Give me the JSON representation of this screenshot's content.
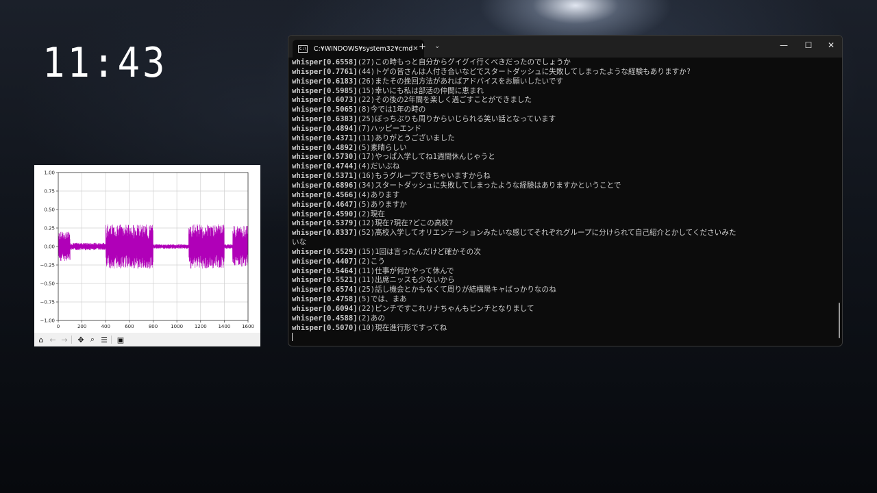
{
  "clock": {
    "time": "11:43"
  },
  "plot": {
    "toolbar_icons": [
      "home-icon",
      "back-arrow-icon",
      "forward-arrow-icon",
      "move-icon",
      "zoom-icon",
      "configure-icon",
      "save-icon"
    ]
  },
  "chart_data": {
    "type": "line",
    "yticks": [
      "1.00",
      "0.75",
      "0.50",
      "0.25",
      "0.00",
      "−0.25",
      "−0.50",
      "−0.75",
      "−1.00"
    ],
    "xticks": [
      "0",
      "200",
      "400",
      "600",
      "800",
      "1000",
      "1200",
      "1400",
      "1600"
    ],
    "xlim": [
      0,
      1600
    ],
    "ylim": [
      -1.0,
      1.0
    ],
    "grid": true,
    "series": [
      {
        "color": "#b000b8",
        "segments": [
          {
            "x": [
              0,
              100
            ],
            "amp": 0.2
          },
          {
            "x": [
              100,
              400
            ],
            "amp": 0.05
          },
          {
            "x": [
              400,
              800
            ],
            "amp": 0.3
          },
          {
            "x": [
              800,
              1100
            ],
            "amp": 0.03
          },
          {
            "x": [
              1100,
              1400
            ],
            "amp": 0.3
          },
          {
            "x": [
              1400,
              1470
            ],
            "amp": 0.03
          },
          {
            "x": [
              1470,
              1600
            ],
            "amp": 0.28
          }
        ]
      }
    ]
  },
  "terminal": {
    "tab_title": "C:¥WINDOWS¥system32¥cmd",
    "tab_icon_text": "C:\\",
    "new_tab": "+",
    "dropdown": "⌄",
    "minimize": "—",
    "maximize": "☐",
    "close": "✕",
    "lines": [
      {
        "prefix": "whisper[0.6558]",
        "text": "(27)この時もっと自分からグイグイ行くべきだったのでしょうか"
      },
      {
        "prefix": "whisper[0.7761]",
        "text": "(44)トゲの皆さんは人付き合いなどでスタートダッシュに失敗してしまったような経験もありますか?"
      },
      {
        "prefix": "whisper[0.6183]",
        "text": "(26)またその挽回方法があればアドバイスをお願いしたいです"
      },
      {
        "prefix": "whisper[0.5985]",
        "text": "(15)幸いにも私は部活の仲間に恵まれ"
      },
      {
        "prefix": "whisper[0.6073]",
        "text": "(22)その後の2年間を楽しく過ごすことができました"
      },
      {
        "prefix": "whisper[0.5065]",
        "text": "(8)今では1年の時の"
      },
      {
        "prefix": "whisper[0.6383]",
        "text": "(25)ぼっちぶりも周りからいじられる笑い話となっています"
      },
      {
        "prefix": "whisper[0.4894]",
        "text": "(7)ハッピーエンド"
      },
      {
        "prefix": "whisper[0.4371]",
        "text": "(11)ありがとうございました"
      },
      {
        "prefix": "whisper[0.4892]",
        "text": "(5)素晴らしい"
      },
      {
        "prefix": "whisper[0.5730]",
        "text": "(17)やっぱ入学してね1週間休んじゃうと"
      },
      {
        "prefix": "whisper[0.4744]",
        "text": "(4)だいぶね"
      },
      {
        "prefix": "whisper[0.5371]",
        "text": "(16)もうグループできちゃいますからね"
      },
      {
        "prefix": "whisper[0.6896]",
        "text": "(34)スタートダッシュに失敗してしまったような経験はありますかということで"
      },
      {
        "prefix": "whisper[0.4566]",
        "text": "(4)あります"
      },
      {
        "prefix": "whisper[0.4647]",
        "text": "(5)ありますか"
      },
      {
        "prefix": "whisper[0.4590]",
        "text": "(2)現在"
      },
      {
        "prefix": "whisper[0.5379]",
        "text": "(12)現在?現在?どこの高校?"
      },
      {
        "prefix": "whisper[0.8337]",
        "text": "(52)高校入学してオリエンテーションみたいな感じてそれぞれグループに分けられて自己紹介とかしてくださいみた"
      },
      {
        "prefix": "",
        "text": "いな"
      },
      {
        "prefix": "whisper[0.5529]",
        "text": "(15)1回は言ったんだけど確かその次"
      },
      {
        "prefix": "whisper[0.4407]",
        "text": "(2)こう"
      },
      {
        "prefix": "whisper[0.5464]",
        "text": "(11)仕事が何かやって休んで"
      },
      {
        "prefix": "whisper[0.5521]",
        "text": "(11)出席ニッスも少ないから"
      },
      {
        "prefix": "whisper[0.6574]",
        "text": "(25)話し機会とかもなくて周りが結構陽キャばっかりなのね"
      },
      {
        "prefix": "whisper[0.4758]",
        "text": "(5)では、まあ"
      },
      {
        "prefix": "whisper[0.6094]",
        "text": "(22)ピンチですこれリナちゃんもピンチとなりまして"
      },
      {
        "prefix": "whisper[0.4588]",
        "text": "(2)あの"
      },
      {
        "prefix": "whisper[0.5070]",
        "text": "(10)現在進行形ですってね"
      }
    ]
  }
}
